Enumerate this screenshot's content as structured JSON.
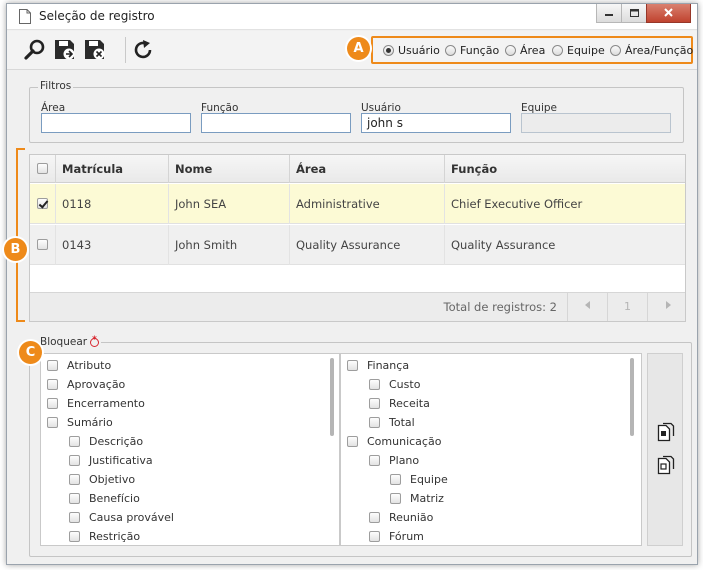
{
  "window": {
    "title": "Seleção de registro",
    "controls": [
      "minimize-icon",
      "restore-icon",
      "close-icon"
    ]
  },
  "toolbar": {
    "icons": [
      "search-icon",
      "save-new-icon",
      "save-close-icon",
      "refresh-icon"
    ],
    "radio_options": [
      {
        "label": "Usuário",
        "checked": true
      },
      {
        "label": "Função",
        "checked": false
      },
      {
        "label": "Área",
        "checked": false
      },
      {
        "label": "Equipe",
        "checked": false
      },
      {
        "label": "Área/Função",
        "checked": false
      }
    ]
  },
  "callouts": {
    "a": "A",
    "b": "B",
    "c": "C"
  },
  "filters": {
    "legend": "Filtros",
    "fields": [
      {
        "label": "Área",
        "value": ""
      },
      {
        "label": "Função",
        "value": ""
      },
      {
        "label": "Usuário",
        "value": "john s"
      },
      {
        "label": "Equipe",
        "value": ""
      }
    ]
  },
  "grid": {
    "columns": [
      "Matrícula",
      "Nome",
      "Área",
      "Função"
    ],
    "rows": [
      {
        "checked": true,
        "cells": [
          "0118",
          "John SEA",
          "Administrative",
          "Chief Executive Officer"
        ]
      },
      {
        "checked": false,
        "cells": [
          "0143",
          "John Smith",
          "Quality Assurance",
          "Quality Assurance"
        ]
      }
    ],
    "footer": {
      "total": "Total de registros: 2",
      "page": "1"
    }
  },
  "block": {
    "legend": "Bloquear",
    "left_tree": [
      {
        "label": "Atributo",
        "level": 0
      },
      {
        "label": "Aprovação",
        "level": 0
      },
      {
        "label": "Encerramento",
        "level": 0
      },
      {
        "label": "Sumário",
        "level": 0
      },
      {
        "label": "Descrição",
        "level": 1
      },
      {
        "label": "Justificativa",
        "level": 1
      },
      {
        "label": "Objetivo",
        "level": 1
      },
      {
        "label": "Benefício",
        "level": 1
      },
      {
        "label": "Causa provável",
        "level": 1
      },
      {
        "label": "Restrição",
        "level": 1
      }
    ],
    "right_tree": [
      {
        "label": "Finança",
        "level": 0
      },
      {
        "label": "Custo",
        "level": 1
      },
      {
        "label": "Receita",
        "level": 1
      },
      {
        "label": "Total",
        "level": 1
      },
      {
        "label": "Comunicação",
        "level": 0
      },
      {
        "label": "Plano",
        "level": 1
      },
      {
        "label": "Equipe",
        "level": 2
      },
      {
        "label": "Matriz",
        "level": 2
      },
      {
        "label": "Reunião",
        "level": 1
      },
      {
        "label": "Fórum",
        "level": 1
      }
    ],
    "side_icons": [
      "check-all-icon",
      "uncheck-all-icon"
    ]
  }
}
